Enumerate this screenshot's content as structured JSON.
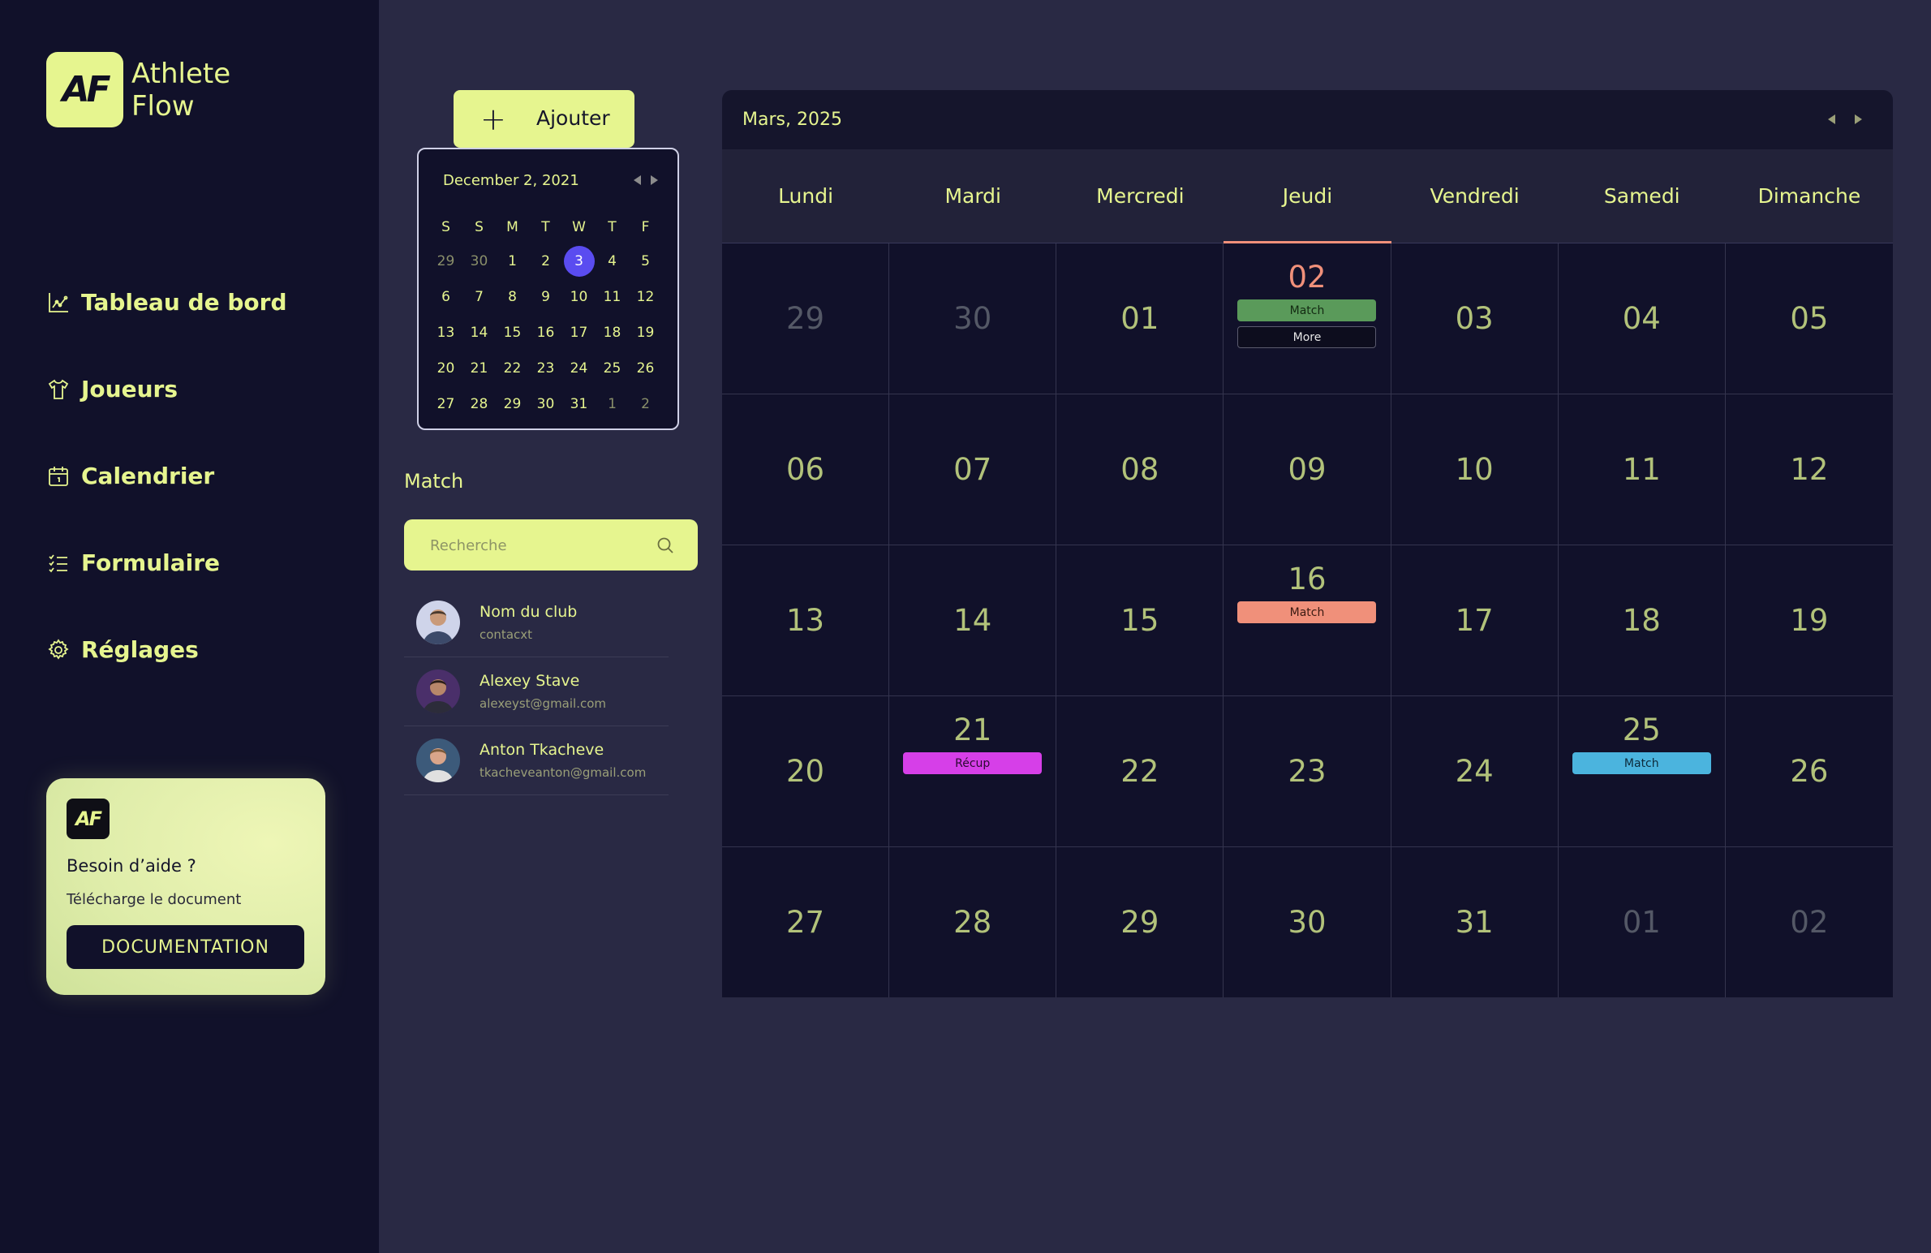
{
  "app": {
    "logo_mark": "AF",
    "name_line1": "Athlete",
    "name_line2": "Flow"
  },
  "colors": {
    "accent": "#e6f58f",
    "background": "#292944",
    "sidebar": "#11112a",
    "selected_day": "#5a4cf0",
    "today": "#f0907a"
  },
  "nav": [
    {
      "label": "Tableau de bord",
      "icon": "chart-icon"
    },
    {
      "label": "Joueurs",
      "icon": "shirt-icon"
    },
    {
      "label": "Calendrier",
      "icon": "calendar-icon"
    },
    {
      "label": "Formulaire",
      "icon": "checklist-icon"
    },
    {
      "label": "Réglages",
      "icon": "gear-icon"
    }
  ],
  "help": {
    "logo_mark": "AF",
    "title": "Besoin d’aide ?",
    "subtitle": "Télécharge le document",
    "button": "DOCUMENTATION"
  },
  "add_button": {
    "icon": "+",
    "label": "Ajouter"
  },
  "mini_calendar": {
    "header": "December 2, 2021",
    "weekdays": [
      "S",
      "S",
      "M",
      "T",
      "W",
      "T",
      "F"
    ],
    "weeks": [
      [
        "29",
        "30",
        "1",
        "2",
        "3",
        "4",
        "5"
      ],
      [
        "6",
        "7",
        "8",
        "9",
        "10",
        "11",
        "12"
      ],
      [
        "13",
        "14",
        "15",
        "16",
        "17",
        "18",
        "19"
      ],
      [
        "20",
        "21",
        "22",
        "23",
        "24",
        "25",
        "26"
      ],
      [
        "27",
        "28",
        "29",
        "30",
        "31",
        "1",
        "2"
      ]
    ],
    "selected": "3"
  },
  "match_section": {
    "title": "Match",
    "search_placeholder": "Recherche",
    "contacts": [
      {
        "name": "Nom du club",
        "email": "contacxt"
      },
      {
        "name": "Alexey Stave",
        "email": "alexeyst@gmail.com"
      },
      {
        "name": "Anton Tkacheve",
        "email": "tkacheveanton@gmail.com"
      }
    ]
  },
  "calendar": {
    "title": "Mars, 2025",
    "weekdays": [
      "Lundi",
      "Mardi",
      "Mercredi",
      "Jeudi",
      "Vendredi",
      "Samedi",
      "Dimanche"
    ],
    "weeks": [
      [
        "29",
        "30",
        "01",
        "02",
        "03",
        "04",
        "05"
      ],
      [
        "06",
        "07",
        "08",
        "09",
        "10",
        "11",
        "12"
      ],
      [
        "13",
        "14",
        "15",
        "16",
        "17",
        "18",
        "19"
      ],
      [
        "20",
        "21",
        "22",
        "23",
        "24",
        "25",
        "26"
      ],
      [
        "27",
        "28",
        "29",
        "30",
        "31",
        "01",
        "02"
      ]
    ],
    "events": {
      "0-3": [
        {
          "label": "Match",
          "color": "#5a9a5a"
        },
        {
          "label": "More",
          "color": "#0d0d1e"
        }
      ],
      "2-3": [
        {
          "label": "Match",
          "color": "#f0907a"
        }
      ],
      "3-1": [
        {
          "label": "Récup",
          "color": "#d63fe8"
        }
      ],
      "3-5": [
        {
          "label": "Match",
          "color": "#4bb4de"
        }
      ]
    }
  }
}
